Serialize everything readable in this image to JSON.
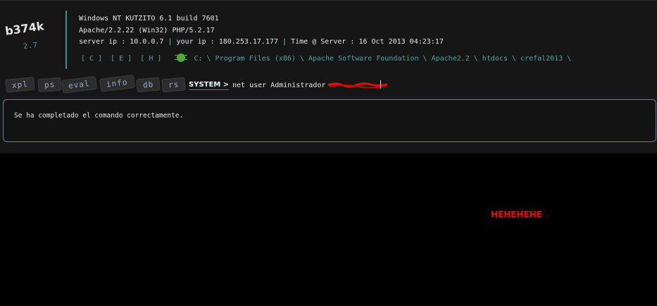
{
  "logo": {
    "name": "b374k",
    "version": "2.7"
  },
  "server_info": {
    "os": "Windows NT KUTZITO 6.1 build 7601",
    "software": "Apache/2.2.22 (Win32) PHP/5.2.17",
    "server_ip_label": "server ip : 10.0.0.7",
    "your_ip_label": "your ip : 180.253.17.177",
    "time_label": "Time @ Server : 16 Oct 2013 04:23:17",
    "separator": "|"
  },
  "drives": [
    "[ C ]",
    "[ E ]",
    "[ H ]"
  ],
  "path": "C: \\ Program Files (x86) \\ Apache Software Foundation \\ Apache2.2 \\ htdocs \\ crefal2013 \\",
  "tabs": [
    "xpl",
    "ps",
    "eval",
    "info",
    "db",
    "rs"
  ],
  "console": {
    "prompt": "SYSTEM >",
    "command": "net user Administrador"
  },
  "output": "Se ha completado el comando correctamente.",
  "overlay_text": "HEHEHEHE",
  "colors": {
    "accent": "#3d8f94",
    "text": "#e6e6e6",
    "overlay": "#e01010"
  }
}
